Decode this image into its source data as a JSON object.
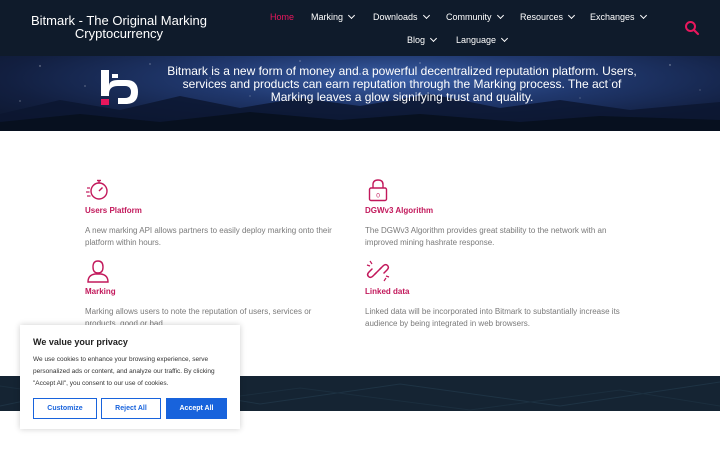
{
  "header": {
    "brand": "Bitmark - The Original Marking Cryptocurrency",
    "nav": [
      {
        "label": "Home",
        "active": true,
        "dropdown": false
      },
      {
        "label": "Marking",
        "dropdown": true
      },
      {
        "label": "Downloads",
        "dropdown": true
      },
      {
        "label": "Community",
        "dropdown": true
      },
      {
        "label": "Resources",
        "dropdown": true
      },
      {
        "label": "Exchanges",
        "dropdown": true
      },
      {
        "label": "Blog",
        "dropdown": true
      },
      {
        "label": "Language",
        "dropdown": true
      }
    ],
    "search_icon": "search-icon"
  },
  "hero": {
    "text": "Bitmark is a new form of money and a powerful decentralized reputation platform. Users, services and products can earn reputation through the Marking process. The act of Marking leaves a glow signifying trust and quality."
  },
  "features": [
    {
      "icon": "stopwatch-icon",
      "title": "Users Platform",
      "desc": "A new marking API allows partners to easily deploy marking onto their platform within hours."
    },
    {
      "icon": "lock-icon",
      "title": "DGWv3 Algorithm",
      "desc": "The DGWv3 Algorithm provides great stability to the network with an improved mining hashrate response."
    },
    {
      "icon": "user-icon",
      "title": "Marking",
      "desc": "Marking allows users to note the reputation of users, services or products, good or bad."
    },
    {
      "icon": "link-icon",
      "title": "Linked data",
      "desc": "Linked data will be incorporated into Bitmark to substantially increase its audience by being integrated in web browsers."
    }
  ],
  "cookie": {
    "title": "We value your privacy",
    "text": "We use cookies to enhance your browsing experience, serve personalized ads or content, and analyze our traffic. By clicking \"Accept All\", you consent to our use of cookies.",
    "customize": "Customize",
    "reject": "Reject All",
    "accept": "Accept All"
  },
  "colors": {
    "header_bg": "#0f1b2b",
    "accent": "#e8175d",
    "feature_title": "#c2185b",
    "button_blue": "#1863dc"
  }
}
